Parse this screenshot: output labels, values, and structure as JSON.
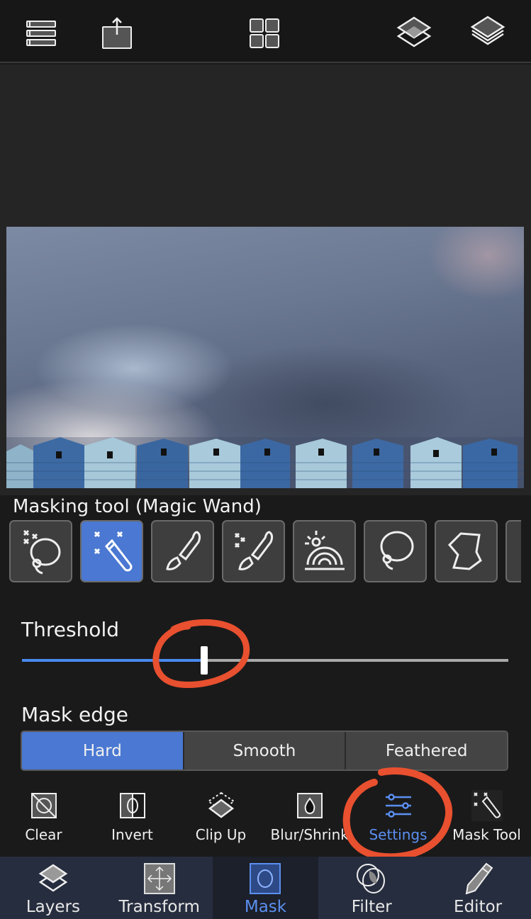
{
  "topbar": {
    "icons": [
      "list-icon",
      "share-icon",
      "grid-icon",
      "layer-merge-icon",
      "layers-stack-icon"
    ]
  },
  "canvas": {
    "image_description": "Cloudy sky over a row of blue and light-blue beach huts"
  },
  "masking": {
    "title": "Masking tool (Magic Wand)",
    "tools": [
      {
        "name": "magic-lasso",
        "active": false
      },
      {
        "name": "magic-wand",
        "active": true
      },
      {
        "name": "brush",
        "active": false
      },
      {
        "name": "magic-brush",
        "active": false
      },
      {
        "name": "gradient-radial",
        "active": false
      },
      {
        "name": "lasso",
        "active": false
      },
      {
        "name": "polygon",
        "active": false
      },
      {
        "name": "more-tool",
        "active": false
      }
    ]
  },
  "threshold": {
    "label": "Threshold",
    "value_fraction": 0.375
  },
  "mask_edge": {
    "label": "Mask edge",
    "options": [
      "Hard",
      "Smooth",
      "Feathered"
    ],
    "selected": "Hard"
  },
  "actions": [
    {
      "label": "Clear",
      "icon": "clear-mask-icon"
    },
    {
      "label": "Invert",
      "icon": "invert-mask-icon"
    },
    {
      "label": "Clip Up",
      "icon": "clip-up-icon"
    },
    {
      "label": "Blur/Shrink",
      "icon": "blur-shrink-icon"
    },
    {
      "label": "Settings",
      "icon": "settings-sliders-icon",
      "highlighted": true
    },
    {
      "label": "Mask Tool",
      "icon": "mask-tool-wand-icon"
    }
  ],
  "tabs": [
    {
      "label": "Layers",
      "icon": "layers-icon"
    },
    {
      "label": "Transform",
      "icon": "transform-icon"
    },
    {
      "label": "Mask",
      "icon": "mask-icon",
      "active": true
    },
    {
      "label": "Filter",
      "icon": "filter-icon"
    },
    {
      "label": "Editor",
      "icon": "pencil-icon"
    }
  ],
  "colors": {
    "accent": "#4a78d2",
    "accent_text": "#5b8ff0",
    "slider_fill": "#4a88ee",
    "annotation": "#e8502f",
    "background": "#1a1a1a",
    "tabbar": "#262d3e"
  }
}
